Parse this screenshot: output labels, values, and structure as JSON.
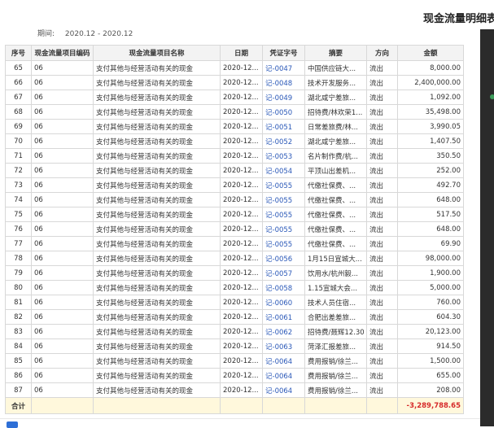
{
  "report": {
    "title": "现金流量明细表",
    "period_label": "期间:",
    "period_value": "2020.12 - 2020.12"
  },
  "table": {
    "headers": [
      "序号",
      "现金流量项目编码",
      "现金流量项目名称",
      "日期",
      "凭证字号",
      "摘要",
      "方向",
      "金额"
    ],
    "rows": [
      [
        "65",
        "06",
        "支付其他与经营活动有关的现金",
        "2020-12...",
        "记-0047",
        "中国供应链大...",
        "流出",
        "8,000.00"
      ],
      [
        "66",
        "06",
        "支付其他与经营活动有关的现金",
        "2020-12...",
        "记-0048",
        "技术开发服务...",
        "流出",
        "2,400,000.00"
      ],
      [
        "67",
        "06",
        "支付其他与经营活动有关的现金",
        "2020-12...",
        "记-0049",
        "湖北咸宁差旅...",
        "流出",
        "1,092.00"
      ],
      [
        "68",
        "06",
        "支付其他与经营活动有关的现金",
        "2020-12...",
        "记-0050",
        "招待费/林欢荣1...",
        "流出",
        "35,498.00"
      ],
      [
        "69",
        "06",
        "支付其他与经营活动有关的现金",
        "2020-12...",
        "记-0051",
        "日常差旅费/林...",
        "流出",
        "3,990.05"
      ],
      [
        "70",
        "06",
        "支付其他与经营活动有关的现金",
        "2020-12...",
        "记-0052",
        "湖北咸宁差旅...",
        "流出",
        "1,407.50"
      ],
      [
        "71",
        "06",
        "支付其他与经营活动有关的现金",
        "2020-12...",
        "记-0053",
        "名片制作费/杭...",
        "流出",
        "350.50"
      ],
      [
        "72",
        "06",
        "支付其他与经营活动有关的现金",
        "2020-12...",
        "记-0054",
        "平顶山出差机...",
        "流出",
        "252.00"
      ],
      [
        "73",
        "06",
        "支付其他与经营活动有关的现金",
        "2020-12...",
        "记-0055",
        "代缴社保费、...",
        "流出",
        "492.70"
      ],
      [
        "74",
        "06",
        "支付其他与经营活动有关的现金",
        "2020-12...",
        "记-0055",
        "代缴社保费、...",
        "流出",
        "648.00"
      ],
      [
        "75",
        "06",
        "支付其他与经营活动有关的现金",
        "2020-12...",
        "记-0055",
        "代缴社保费、...",
        "流出",
        "517.50"
      ],
      [
        "76",
        "06",
        "支付其他与经营活动有关的现金",
        "2020-12...",
        "记-0055",
        "代缴社保费、...",
        "流出",
        "648.00"
      ],
      [
        "77",
        "06",
        "支付其他与经营活动有关的现金",
        "2020-12...",
        "记-0055",
        "代缴社保费、...",
        "流出",
        "69.90"
      ],
      [
        "78",
        "06",
        "支付其他与经营活动有关的现金",
        "2020-12...",
        "记-0056",
        "1月15日宣城大...",
        "流出",
        "98,000.00"
      ],
      [
        "79",
        "06",
        "支付其他与经营活动有关的现金",
        "2020-12...",
        "记-0057",
        "饮用水/杭州毅...",
        "流出",
        "1,900.00"
      ],
      [
        "80",
        "06",
        "支付其他与经营活动有关的现金",
        "2020-12...",
        "记-0058",
        "1.15宣城大会...",
        "流出",
        "5,000.00"
      ],
      [
        "81",
        "06",
        "支付其他与经营活动有关的现金",
        "2020-12...",
        "记-0060",
        "技术人员住宿...",
        "流出",
        "760.00"
      ],
      [
        "82",
        "06",
        "支付其他与经营活动有关的现金",
        "2020-12...",
        "记-0061",
        "合肥出差差旅...",
        "流出",
        "604.30"
      ],
      [
        "83",
        "06",
        "支付其他与经营活动有关的现金",
        "2020-12...",
        "记-0062",
        "招待费/聂辉12.30",
        "流出",
        "20,123.00"
      ],
      [
        "84",
        "06",
        "支付其他与经营活动有关的现金",
        "2020-12...",
        "记-0063",
        "菏泽汇报差旅...",
        "流出",
        "914.50"
      ],
      [
        "85",
        "06",
        "支付其他与经营活动有关的现金",
        "2020-12...",
        "记-0064",
        "费用报销/徐兰...",
        "流出",
        "1,500.00"
      ],
      [
        "86",
        "06",
        "支付其他与经营活动有关的现金",
        "2020-12...",
        "记-0064",
        "费用报销/徐兰...",
        "流出",
        "655.00"
      ],
      [
        "87",
        "06",
        "支付其他与经营活动有关的现金",
        "2020-12...",
        "记-0064",
        "费用报销/徐兰...",
        "流出",
        "208.00"
      ]
    ],
    "total_label": "合计",
    "total_value": "-3,289,788.65"
  },
  "colors": {
    "voucher_link": "#2a58b8",
    "total_negative": "#d62a2a",
    "total_row_bg": "#fff8dc"
  }
}
